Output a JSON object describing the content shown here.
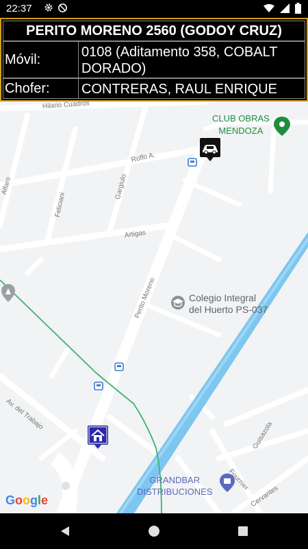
{
  "status_bar": {
    "time": "22:37",
    "icons_left": [
      "gear-icon",
      "at-sign-icon"
    ],
    "icons_right": [
      "wifi-icon",
      "signal-icon",
      "battery-icon"
    ]
  },
  "info_panel": {
    "address": "PERITO MORENO 2560 (GODOY CRUZ)",
    "movil_label": "Móvil:",
    "movil_value": "0108 (Aditamento 358, COBALT DORADO)",
    "chofer_label": "Chofer:",
    "chofer_value": "CONTRERAS, RAUL ENRIQUE",
    "border_color": "#d4a017"
  },
  "map": {
    "streets": {
      "hilario_cuadros": "Hilario Cuadros",
      "roffo": "Roffo A.",
      "alfaro": "Alfaro",
      "felicianl": "Feliciani",
      "gargiulo": "Gargiulo",
      "artigas": "Artigas",
      "perito_moreno": "Perito Moreno",
      "av_del_trabajo": "Av. del Trabajo",
      "guisazola": "Guisazola",
      "fournier": "Fournier",
      "cervantes": "Cervantes"
    },
    "pois": {
      "club_line1": "CLUB OBRAS",
      "club_line2": "MENDOZA",
      "colegio_line1": "Colegio Integral",
      "colegio_line2": "del Huerto PS-037",
      "grandbar_line1": "GRANDBAR",
      "grandbar_line2": "DISTRIBUCIONES"
    },
    "markers": [
      "car-marker",
      "home-marker"
    ],
    "google": [
      "G",
      "o",
      "o",
      "g",
      "l",
      "e"
    ],
    "colors": {
      "water": "#7dc6f0",
      "road": "#ffffff",
      "route": "#3cb371",
      "poi_green": "#1e8e3e",
      "poi_blue": "#5b6abf",
      "poi_gray": "#757575"
    }
  },
  "nav_bar": {
    "buttons": [
      "back-button",
      "home-button",
      "recents-button"
    ]
  }
}
